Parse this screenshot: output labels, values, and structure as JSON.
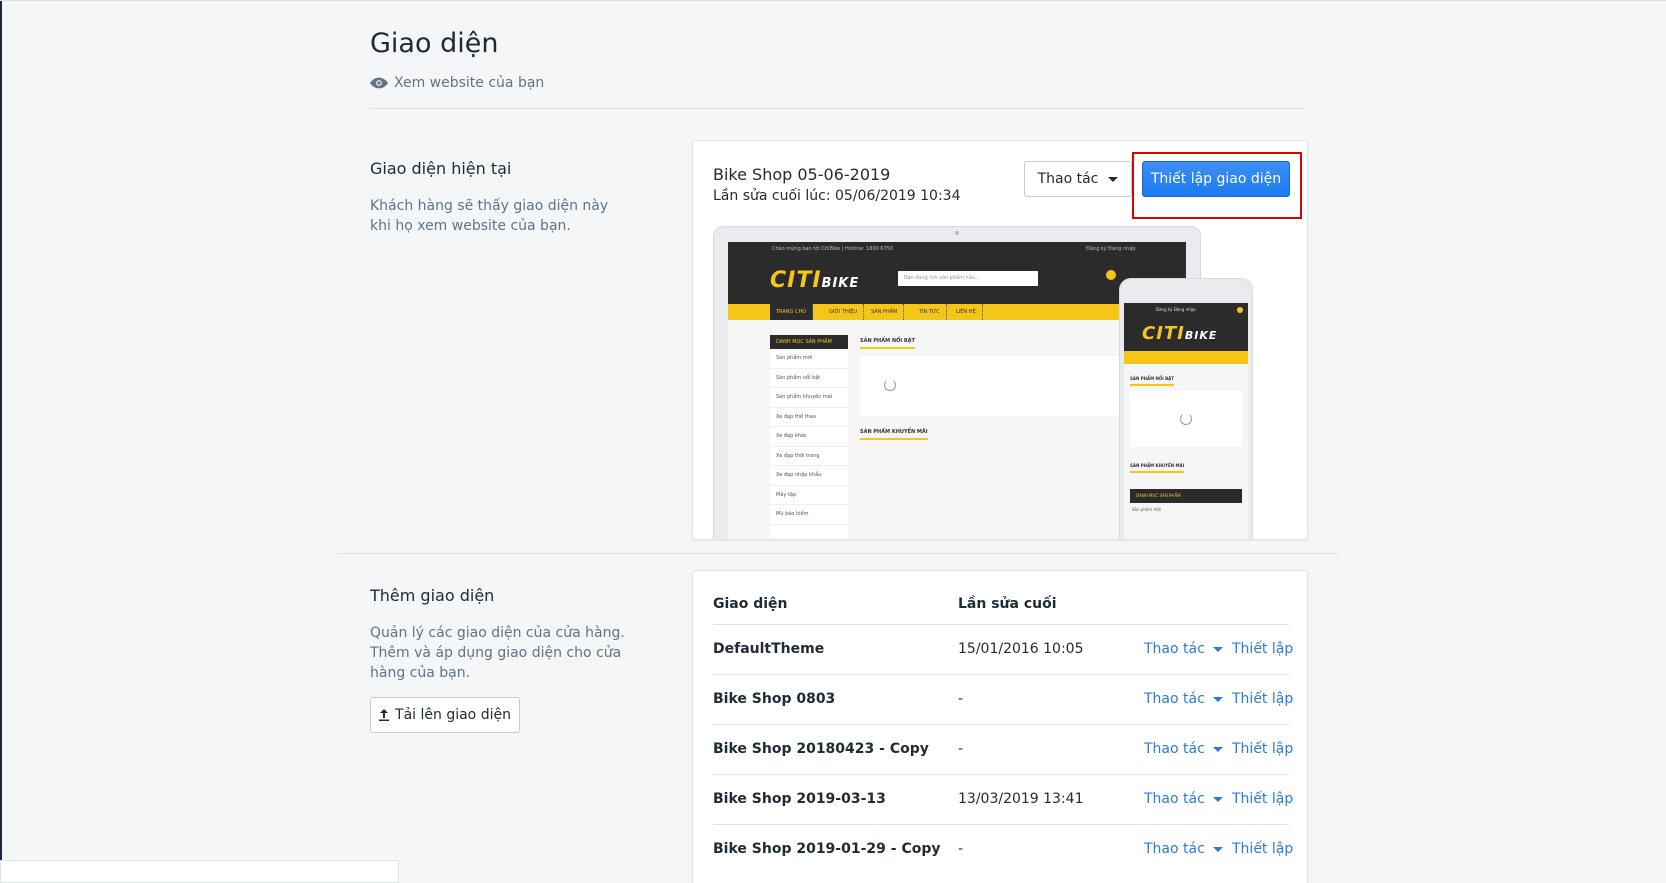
{
  "page": {
    "title": "Giao diện",
    "view_site_link": "Xem website của bạn"
  },
  "current_theme": {
    "section_title": "Giao diện hiện tại",
    "section_desc": "Khách hàng sẽ thấy giao diện này khi họ xem website của bạn.",
    "name": "Bike Shop 05-06-2019",
    "last_edited": "Lần sửa cuối lúc: 05/06/2019 10:34",
    "actions_label": "Thao tác",
    "customize_label": "Thiết lập giao diện"
  },
  "preview": {
    "topbar_left": "Chào mừng bạn tới CitiBike | Hotline: 1800 6750",
    "topbar_right": "Đăng ký    Đăng nhập",
    "logo_citi": "CITI",
    "logo_bike": "BIKE",
    "search_placeholder": "Bạn đang tìm sản phẩm nào...",
    "nav": [
      "TRANG CHỦ",
      "GIỚI THIỆU",
      "SẢN PHẨM",
      "TIN TỨC",
      "LIÊN HỆ"
    ],
    "sidebar_title": "DANH MỤC SẢN PHẨM",
    "sidebar_items": [
      "Sản phẩm mới",
      "Sản phẩm nổi bật",
      "Sản phẩm khuyến mãi",
      "Xe đạp thể thao",
      "Xe đạp khác",
      "Xe đạp thời trang",
      "Xe đạp nhập khẩu",
      "Máy tập",
      "Mũ bảo hiểm"
    ],
    "featured_title": "SẢN PHẨM NỔI BẬT",
    "promo_title": "SẢN PHẨM KHUYẾN MÃI",
    "phone_top": "Đăng ký  Đăng nhập",
    "phone_sidebar_item": "Sản phẩm mới"
  },
  "more_themes": {
    "section_title": "Thêm giao diện",
    "section_desc": "Quản lý các giao diện của cửa hàng. Thêm và áp dụng giao diện cho cửa hàng của bạn.",
    "upload_label": "Tải lên giao diện",
    "col_theme": "Giao diện",
    "col_last_edit": "Lần sửa cuối",
    "action_label": "Thao tác",
    "set_label": "Thiết lập",
    "rows": [
      {
        "name": "DefaultTheme",
        "date": "15/01/2016 10:05"
      },
      {
        "name": "Bike Shop 0803",
        "date": "-"
      },
      {
        "name": "Bike Shop 20180423 - Copy",
        "date": "-"
      },
      {
        "name": "Bike Shop 2019-03-13",
        "date": "13/03/2019 13:41"
      },
      {
        "name": "Bike Shop 2019-01-29 - Copy",
        "date": "-"
      }
    ]
  }
}
